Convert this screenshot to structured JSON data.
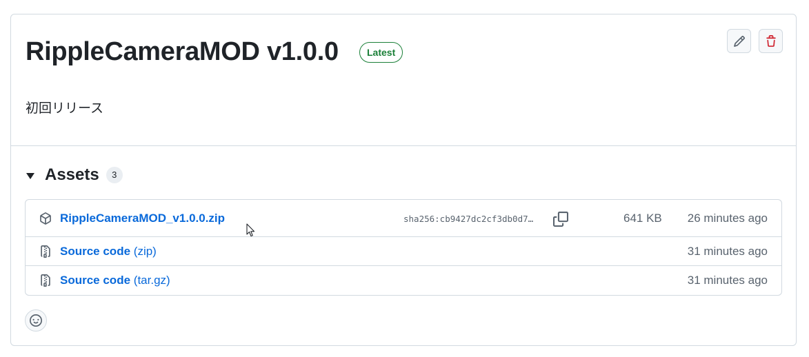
{
  "release": {
    "title": "RippleCameraMOD v1.0.0",
    "badge": "Latest",
    "notes": "初回リリース"
  },
  "assets": {
    "heading": "Assets",
    "count": "3",
    "items": [
      {
        "icon": "package-icon",
        "name": "RippleCameraMOD_v1.0.0.zip",
        "sha": "sha256:cb9427dc2cf3db0d7…",
        "size": "641 KB",
        "time": "26 minutes ago"
      },
      {
        "icon": "file-zip-icon",
        "name": "Source code",
        "suffix": "(zip)",
        "time": "31 minutes ago"
      },
      {
        "icon": "file-zip-icon",
        "name": "Source code",
        "suffix": "(tar.gz)",
        "time": "31 minutes ago"
      }
    ]
  },
  "colors": {
    "link": "#0969da",
    "latest_badge": "#1a7f37",
    "delete": "#cf222e",
    "muted": "#59636e",
    "border": "#d1d9e0"
  }
}
